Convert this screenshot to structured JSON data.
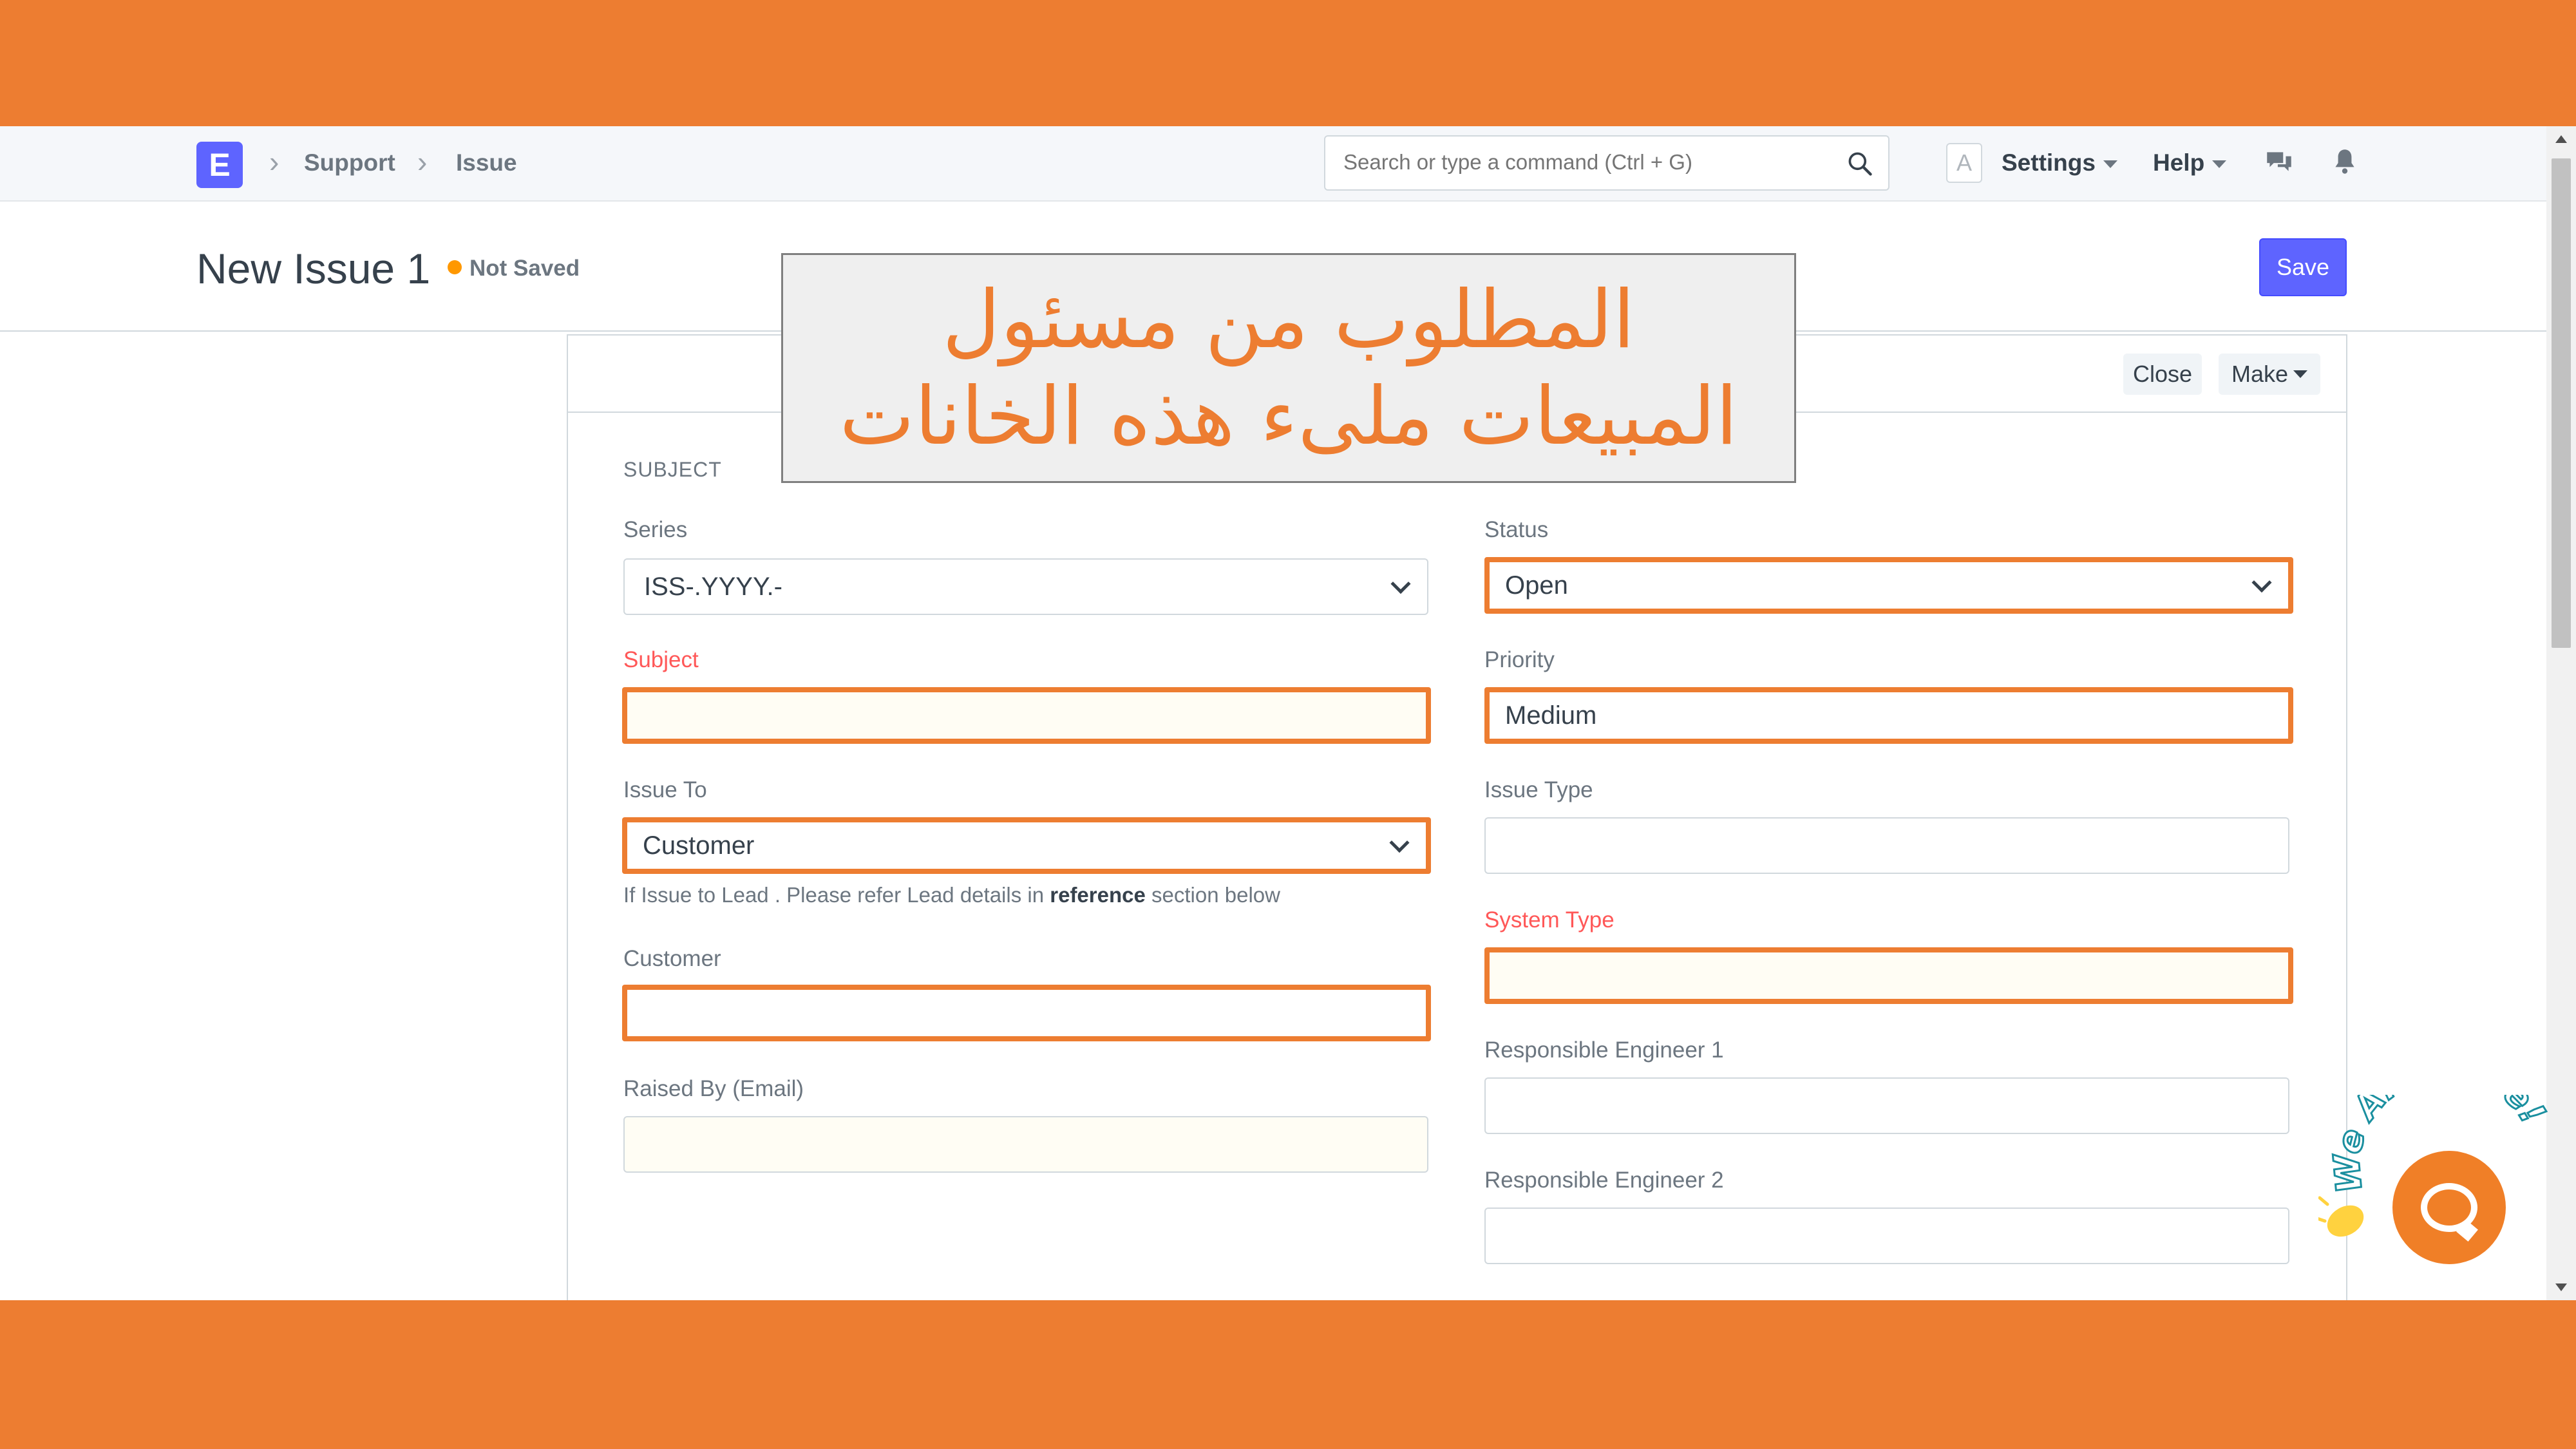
{
  "navbar": {
    "logo_letter": "E",
    "breadcrumbs": [
      "Support",
      "Issue"
    ],
    "search_placeholder": "Search or type a command (Ctrl + G)",
    "avatar_letter": "A",
    "settings_label": "Settings",
    "help_label": "Help"
  },
  "page": {
    "title": "New Issue 1",
    "status": "Not Saved",
    "save_label": "Save"
  },
  "toolbar": {
    "close_label": "Close",
    "make_label": "Make"
  },
  "form": {
    "section": "SUBJECT",
    "series": {
      "label": "Series",
      "value": "ISS-.YYYY.-"
    },
    "subject": {
      "label": "Subject",
      "value": ""
    },
    "issue_to": {
      "label": "Issue To",
      "value": "Customer",
      "help_prefix": "If Issue to Lead . Please refer Lead details in ",
      "help_bold": "reference",
      "help_suffix": " section below"
    },
    "customer": {
      "label": "Customer",
      "value": ""
    },
    "raised_by": {
      "label": "Raised By (Email)",
      "value": ""
    },
    "status": {
      "label": "Status",
      "value": "Open"
    },
    "priority": {
      "label": "Priority",
      "value": "Medium"
    },
    "issue_type": {
      "label": "Issue Type",
      "value": ""
    },
    "system_type": {
      "label": "System Type",
      "value": ""
    },
    "engineer1": {
      "label": "Responsible Engineer 1",
      "value": ""
    },
    "engineer2": {
      "label": "Responsible Engineer 2",
      "value": ""
    }
  },
  "callout": {
    "line1": "المطلوب من مسئول",
    "line2": "المبيعات ملىء هذه الخانات"
  },
  "chat": {
    "badge_text": "We Are Here!"
  },
  "colors": {
    "accent": "#ED7D31",
    "primary": "#5e64ff",
    "required": "#ff5858"
  }
}
